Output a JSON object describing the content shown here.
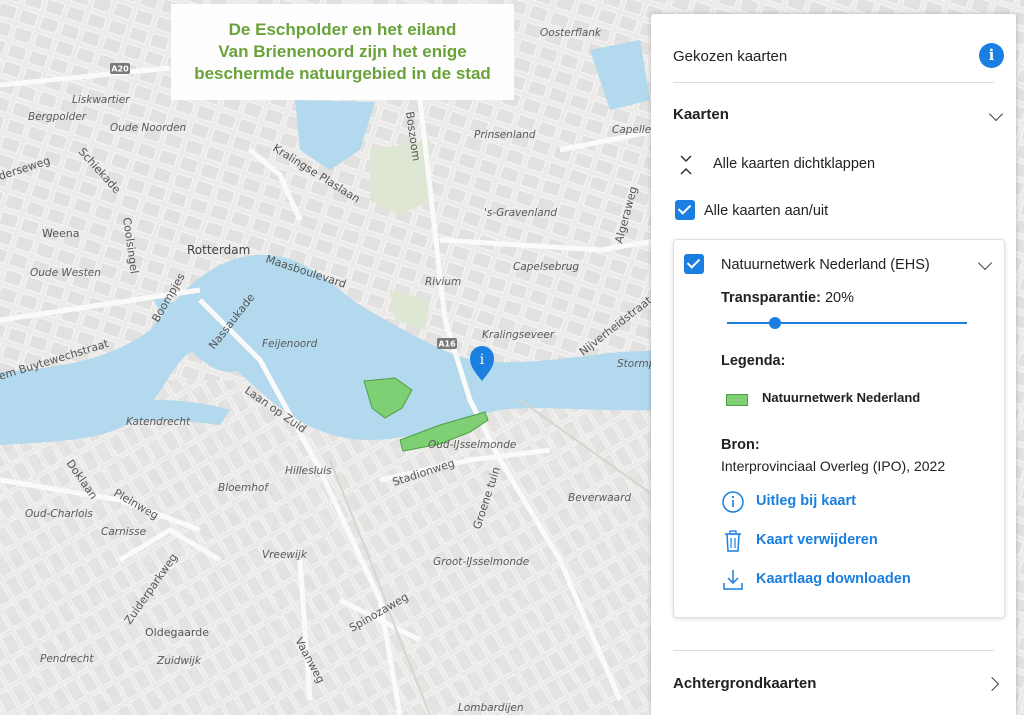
{
  "map": {
    "callout_lines": [
      "De Eschpolder en het eiland",
      "Van Brienenoord zijn het enige",
      "beschermde natuurgebied in de stad"
    ],
    "labels": {
      "oosterflank": "Oosterflank",
      "liskwartier": "Liskwartier",
      "bergpolder": "Bergpolder",
      "oude_noorden": "Oude Noorden",
      "prinsenland": "Prinsenland",
      "capelle": "Capelle",
      "s_gravenland": "'s-Gravenland",
      "weena": "Weena",
      "rotterdam": "Rotterdam",
      "oude_westen": "Oude Westen",
      "rivium": "Rivium",
      "capelsebrug": "Capelsebrug",
      "kralingseveer": "Kralingseveer",
      "feijenoord": "Feijenoord",
      "katendrecht": "Katendrecht",
      "oud_ijsselmonde": "Oud-IJsselmonde",
      "hillesluis": "Hillesluis",
      "bloemhof": "Bloemhof",
      "oud_charlois": "Oud-Charlois",
      "carnisse": "Carnisse",
      "vreewijk": "Vreewijk",
      "beverwaard": "Beverwaard",
      "groot_ijsselmonde": "Groot-IJsselmonde",
      "oldegaarde": "Oldegaarde",
      "pendrecht": "Pendrecht",
      "zuidwijk": "Zuidwijk",
      "lombardijen": "Lombardijen",
      "stormpolder": "Stormp"
    },
    "roads": {
      "kralingse_plaslaan": "Kralingse Plaslaan",
      "boszoom": "Boszoom",
      "schiekade": "Schiekade",
      "coolsingel": "Coolsingel",
      "maasboulevard": "Maasboulevard",
      "boompjes": "Boompjes",
      "nassaukade": "Nassaukade",
      "buytewechstraat": "em Buytewechstraat",
      "laan_op_zuid": "Laan op Zuid",
      "stadionweg": "Stadionweg",
      "groene_tuin": "Groene tuin",
      "doklaan": "Doklaan",
      "pleinweg": "Pleinweg",
      "zuiderparkweg": "Zuiderparkweg",
      "spinozaweg": "Spinozaweg",
      "vaanweg": "Vaanweg",
      "nijverheidstraat": "Nijverheidstraat",
      "algeraweg": "Algeraweg",
      "kleiweg": "derseweg"
    },
    "shields": {
      "a20": "A20",
      "a16": "A16"
    }
  },
  "panel": {
    "header_title": "Gekozen kaarten",
    "kaarten_title": "Kaarten",
    "collapse_all_label": "Alle kaarten dichtklappen",
    "toggle_all_label": "Alle kaarten aan/uit",
    "layer": {
      "title": "Natuurnetwerk Nederland (EHS)",
      "transparency_label": "Transparantie:",
      "transparency_value": "20%",
      "transparency_fraction": 0.2,
      "legend_heading": "Legenda:",
      "legend_item": "Natuurnetwerk Nederland",
      "source_heading": "Bron:",
      "source_value": "Interprovinciaal Overleg (IPO), 2022",
      "actions": {
        "explain": "Uitleg bij kaart",
        "remove": "Kaart verwijderen",
        "download": "Kaartlaag downloaden"
      }
    },
    "background_maps_title": "Achtergrondkaarten"
  },
  "colors": {
    "accent": "#1a7fe0",
    "nature_fill": "#7fcf74",
    "water": "#b3d9ee",
    "callout_text": "#6aa23a"
  }
}
